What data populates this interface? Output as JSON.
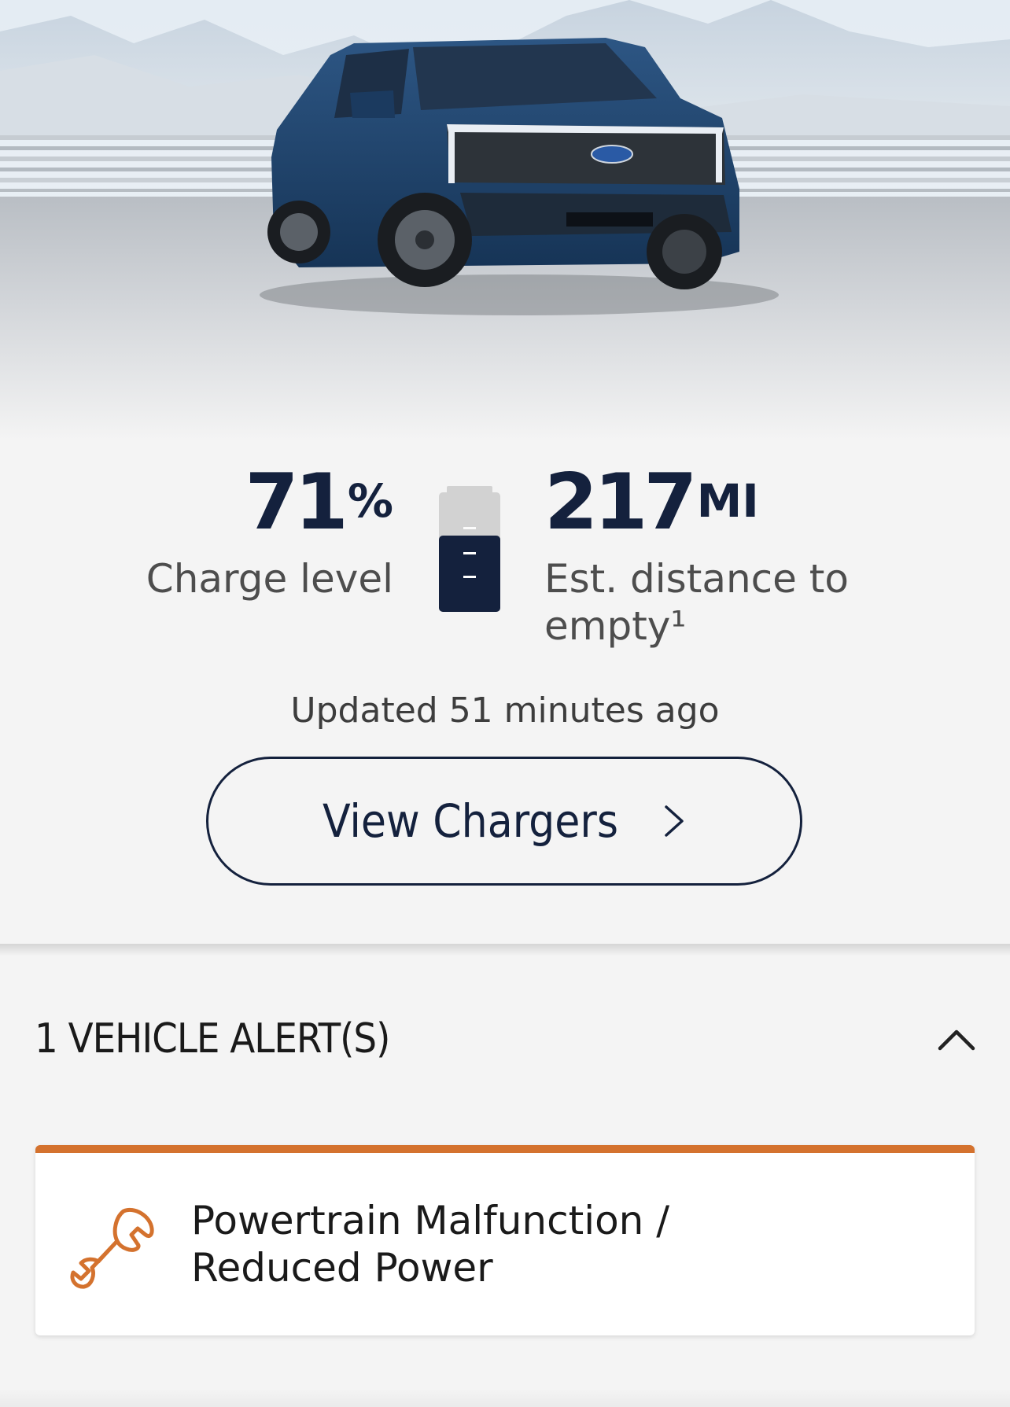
{
  "vehicle": {
    "image_alt": "Vehicle image",
    "charge": {
      "value": "71",
      "unit": "%",
      "label": "Charge level",
      "battery_level": 0.71
    },
    "range": {
      "value": "217",
      "unit": "MI",
      "label": "Est. distance to empty¹"
    },
    "updated": "Updated 51 minutes ago"
  },
  "actions": {
    "view_chargers": "View Chargers"
  },
  "alerts": {
    "title": "1 VEHICLE ALERT(S)",
    "items": [
      {
        "icon": "wrench-icon",
        "text": "Powertrain Malfunction / Reduced Power"
      }
    ]
  },
  "colors": {
    "navy": "#14213d",
    "alert_orange": "#d4722e",
    "background": "#f4f4f4"
  }
}
